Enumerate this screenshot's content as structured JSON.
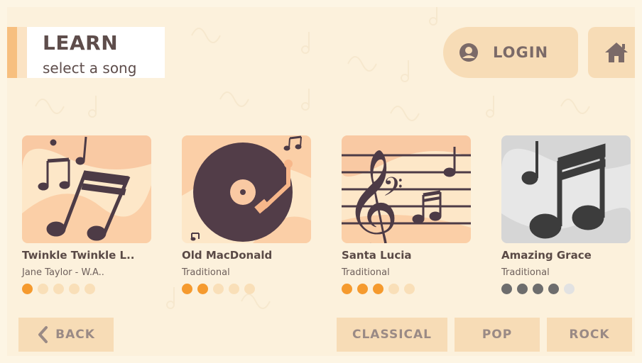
{
  "header": {
    "title": "LEARN",
    "subtitle": "select a song",
    "login_label": "LOGIN",
    "login_icon": "user-circle-icon",
    "home_icon": "home-icon"
  },
  "colors": {
    "accent_orange": "#f59a2e",
    "dot_inactive": "#f9dfb8",
    "dot_gray": "#6d6d6d",
    "dot_gray_inactive": "#e2e2e2",
    "button_bg": "#f7dcb6",
    "thumb_dark": "#523d48"
  },
  "songs": [
    {
      "title": "Twinkle Twinkle L..",
      "artist": "Jane Taylor - W.A..",
      "difficulty": 1,
      "max": 5,
      "locked": false
    },
    {
      "title": "Old MacDonald",
      "artist": "Traditional",
      "difficulty": 2,
      "max": 5,
      "locked": false
    },
    {
      "title": "Santa Lucia",
      "artist": "Traditional",
      "difficulty": 3,
      "max": 5,
      "locked": false
    },
    {
      "title": "Amazing Grace",
      "artist": "Traditional",
      "difficulty": 4,
      "max": 5,
      "locked": true
    }
  ],
  "footer": {
    "back_label": "BACK",
    "categories": [
      "CLASSICAL",
      "POP",
      "ROCK"
    ]
  }
}
